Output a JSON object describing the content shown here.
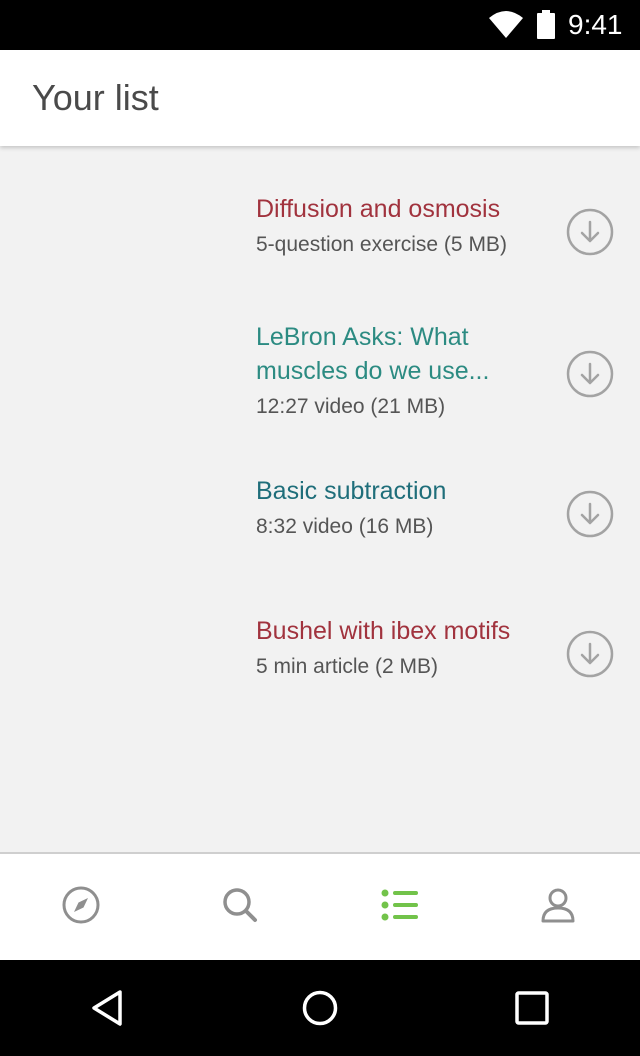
{
  "status_bar": {
    "time": "9:41"
  },
  "header": {
    "title": "Your list"
  },
  "items": [
    {
      "title": "Diffusion and osmosis",
      "meta": "5-question exercise (5 MB)",
      "color": "#a1333e"
    },
    {
      "title": "LeBron Asks: What muscles do we use...",
      "meta": "12:27 video (21 MB)",
      "color": "#2c8b82"
    },
    {
      "title": "Basic subtraction",
      "meta": "8:32 video (16 MB)",
      "color": "#1f6e7a"
    },
    {
      "title": "Bushel with ibex motifs",
      "meta": "5 min article (2 MB)",
      "color": "#a1333e"
    }
  ],
  "bottom_nav": {
    "tabs": [
      {
        "icon": "compass-icon",
        "active": false
      },
      {
        "icon": "search-icon",
        "active": false
      },
      {
        "icon": "list-icon",
        "active": true
      },
      {
        "icon": "profile-icon",
        "active": false
      }
    ],
    "active_color": "#72c34a",
    "inactive_color": "#8f8f8f"
  },
  "system_nav": {
    "icons": [
      "back-icon",
      "home-icon",
      "recents-icon"
    ]
  }
}
